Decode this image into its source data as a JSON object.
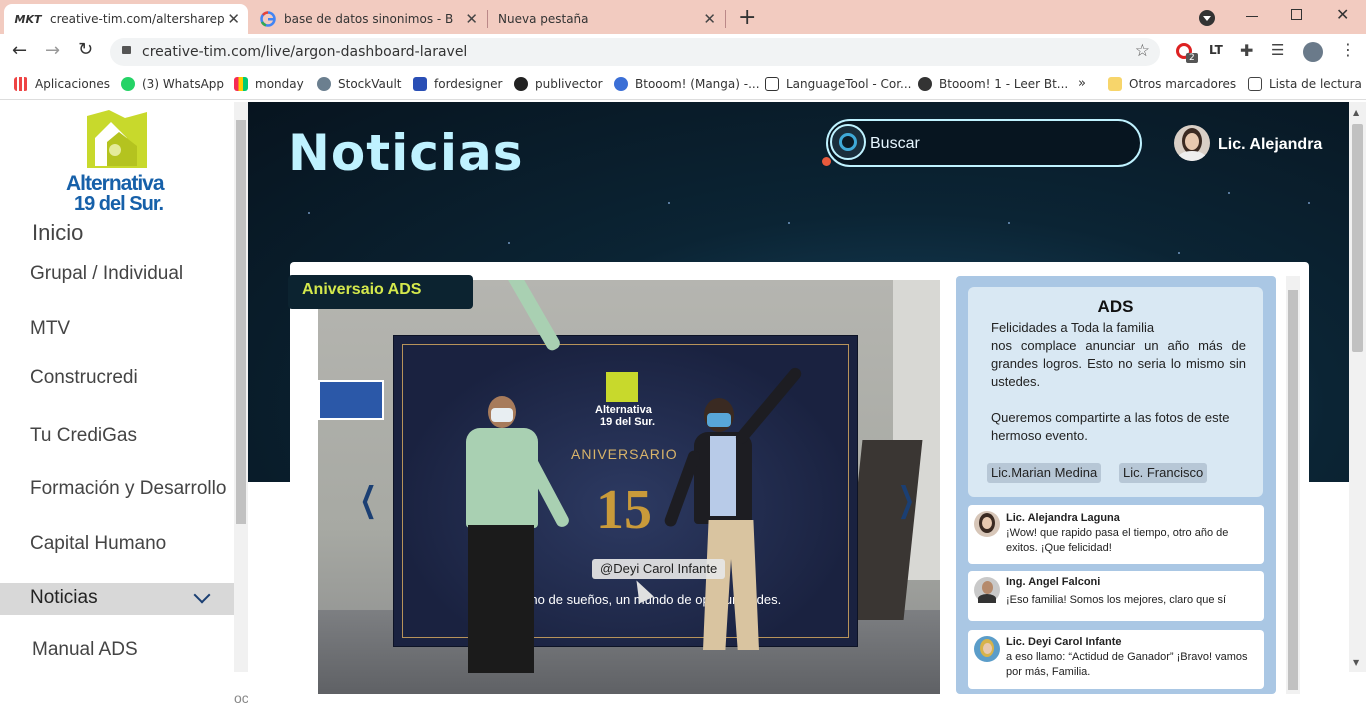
{
  "browser": {
    "tabs": [
      {
        "title": "creative-tim.com/altersharepoint",
        "favicon": "mkt-logo"
      },
      {
        "title": "base de datos sinonimos - Busca",
        "favicon": "google-g"
      },
      {
        "title": "Nueva pestaña",
        "favicon": ""
      }
    ],
    "url": "creative-tim.com/live/argon-dashboard-laravel",
    "bookmarks": [
      "Aplicaciones",
      "(3) WhatsApp",
      "monday",
      "StockVault",
      "fordesigner",
      "publivector",
      "Btooom! (Manga) -...",
      "LanguageTool - Cor...",
      "Btooom! 1 - Leer Bt...",
      "Otros marcadores",
      "Lista de lectura"
    ],
    "extension_badge": "2"
  },
  "sidebar": {
    "logo_line1": "Alternativa",
    "logo_line2": "19 del Sur.",
    "items": [
      "Inicio",
      "Grupal / Individual",
      "MTV",
      "Construcredi",
      "Tu CrediGas",
      "Formación y Desarrollo",
      "Capital Humano",
      "Noticias",
      "Manual ADS"
    ],
    "active": "Noticias",
    "footer_fragment": "ocumenta"
  },
  "header": {
    "title": "Noticias",
    "search_placeholder": "Buscar",
    "user": "Lic. Alejandra"
  },
  "post": {
    "badge": "Aniversaio ADS",
    "photo_tag": "@Deyi Carol Infante",
    "banner": {
      "logo_line1": "Alternativa",
      "logo_line2": "19 del Sur.",
      "heading": "ANIVERSARIO",
      "number": "15",
      "tagline": "Un camino de sueños, un mundo de oportunidades."
    },
    "title": "ADS",
    "body_1": "Felicidades a Toda la familia",
    "body_2": "nos complace anunciar un año más de grandes logros. Esto no seria lo mismo sin ustedes.",
    "body_3": "Queremos compartirte a las fotos de este hermoso evento.",
    "tags": [
      "Lic.Marian Medina",
      "Lic. Francisco"
    ]
  },
  "comments": [
    {
      "author": "Lic. Alejandra Laguna",
      "text": "¡Wow! que rapido pasa el tiempo, otro año de exitos. ¡Que felicidad!"
    },
    {
      "author": "Ing. Angel Falconi",
      "text": "¡Eso familia! Somos los mejores, claro que sí"
    },
    {
      "author": "Lic. Deyi Carol Infante",
      "text": "a eso llamo: “Actidud de Ganador” ¡Bravo! vamos por más, Familia."
    }
  ],
  "colors": {
    "accent_cyan": "#bff2ff",
    "brand_green": "#c8d92c",
    "brand_blue": "#1660a9",
    "panel_blue": "#aac7e4",
    "tab_strip": "#f2cbc0"
  }
}
